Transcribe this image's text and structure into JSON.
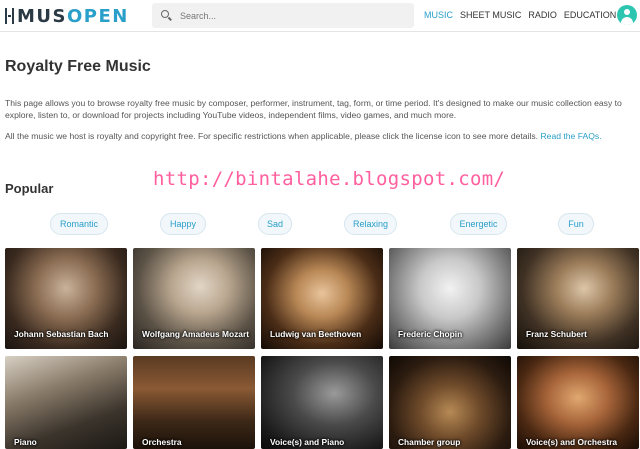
{
  "header": {
    "logo_text_main": "MUS",
    "logo_text_accent": "OPEN",
    "search_placeholder": "Search...",
    "nav": [
      {
        "label": "MUSIC",
        "active": true
      },
      {
        "label": "SHEET MUSIC",
        "active": false
      },
      {
        "label": "RADIO",
        "active": false
      },
      {
        "label": "EDUCATION",
        "active": false
      }
    ]
  },
  "page": {
    "title": "Royalty Free Music",
    "description": "This page allows you to browse royalty free music by composer, performer, instrument, tag, form, or time period. It's designed to make our music collection easy to explore, listen to, or download for projects including YouTube videos, independent films, video games, and much more.",
    "license_note": "All the music we host is royalty and copyright free. For specific restrictions when applicable, please click the license icon to see more details.",
    "faq_link": "Read the FAQs.",
    "popular_heading": "Popular",
    "watermark": "http://bintalahe.blogspot.com/"
  },
  "tags": [
    "Romantic",
    "Happy",
    "Sad",
    "Relaxing",
    "Energetic",
    "Fun"
  ],
  "tiles_row1": [
    "Johann Sebastian Bach",
    "Wolfgang Amadeus Mozart",
    "Ludwig van Beethoven",
    "Frederic Chopin",
    "Franz Schubert"
  ],
  "tiles_row2": [
    "Piano",
    "Orchestra",
    "Voice(s) and Piano",
    "Chamber group",
    "Voice(s) and Orchestra"
  ],
  "colors": {
    "accent": "#2a9fc9",
    "avatar": "#2cc6b0",
    "watermark": "#ff5f9e"
  }
}
